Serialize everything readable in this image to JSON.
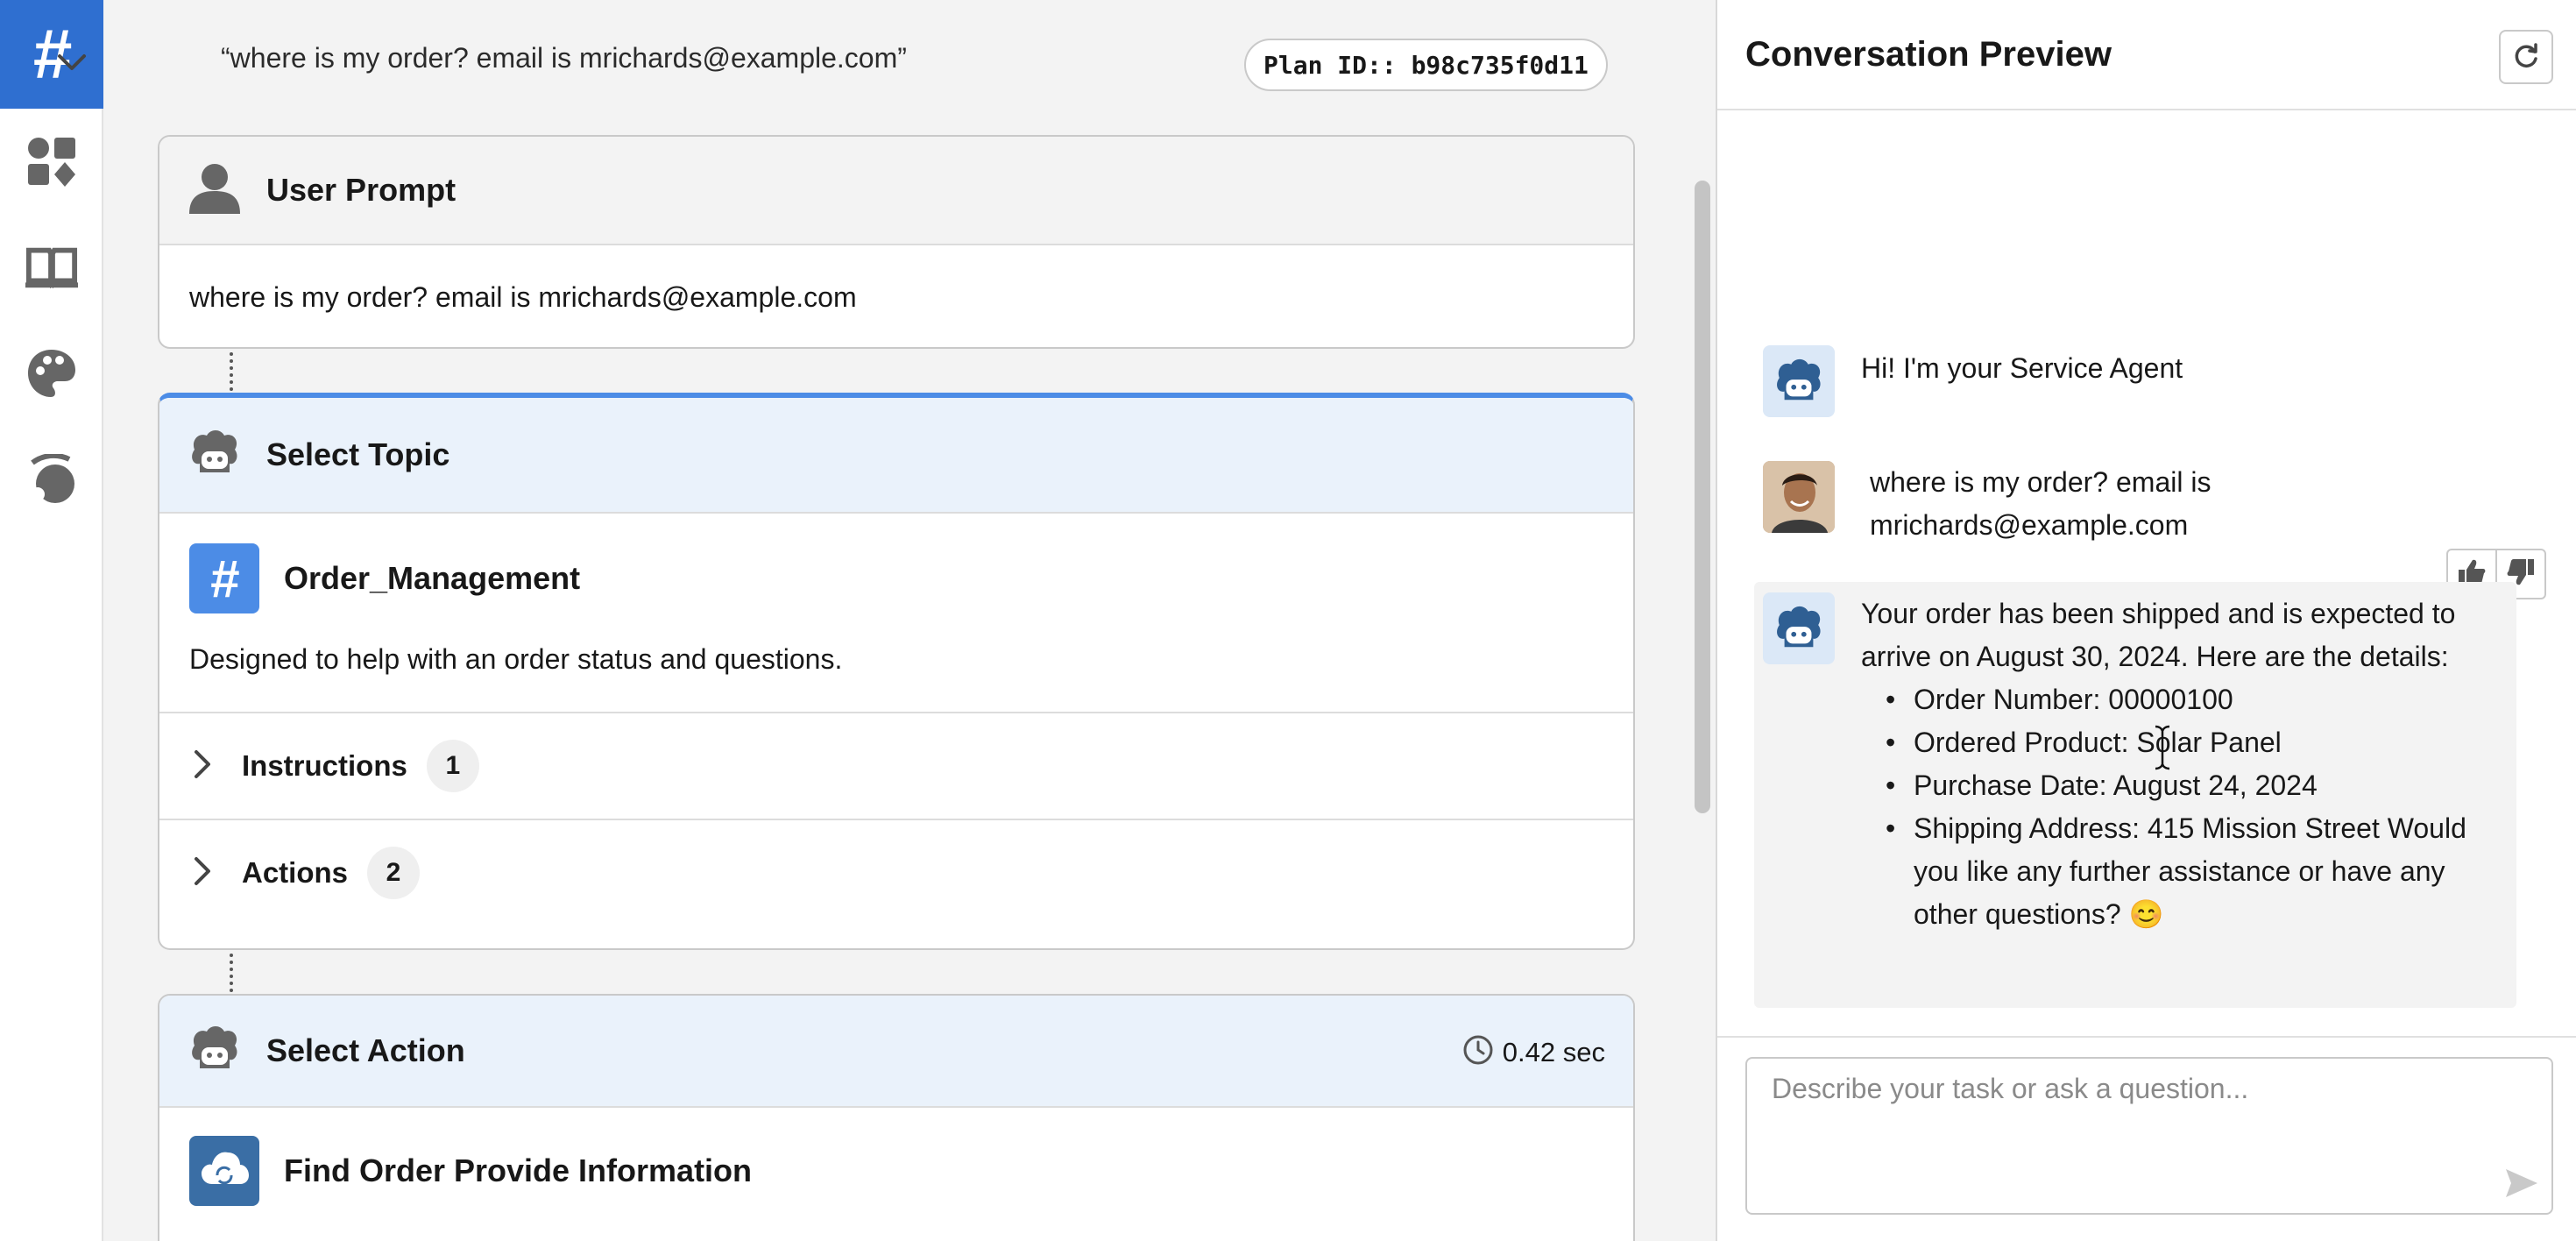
{
  "rail": {
    "top_icon": "hash-icon",
    "items": [
      {
        "icon": "components-icon"
      },
      {
        "icon": "book-icon"
      },
      {
        "icon": "palette-icon"
      },
      {
        "icon": "signal-icon"
      }
    ]
  },
  "plan": {
    "query": "“where is my order? email is mrichards@example.com”",
    "plan_id": "Plan ID:: b98c735f0d11"
  },
  "user_prompt": {
    "title": "User Prompt",
    "text": "where is my order? email is mrichards@example.com"
  },
  "select_topic": {
    "title": "Select Topic",
    "topic_name": "Order_Management",
    "description": "Designed to help with an order status and questions.",
    "instructions_label": "Instructions",
    "instructions_count": "1",
    "actions_label": "Actions",
    "actions_count": "2"
  },
  "select_action": {
    "title": "Select Action",
    "duration": "0.42 sec",
    "action_name": "Find Order Provide Information"
  },
  "preview": {
    "title": "Conversation Preview",
    "greeting": "Hi! I'm your Service Agent",
    "user_message": "where is my order? email is mrichards@example.com",
    "bot_intro": "Your order has been shipped and is expected to arrive on August 30, 2024. Here are the details:",
    "details": [
      "Order Number: 00000100",
      "Ordered Product: Solar Panel",
      "Purchase Date: August 24, 2024",
      "Shipping Address: 415 Mission Street Would you like any further assistance or have any other questions? 😊"
    ],
    "input_placeholder": "Describe your task or ask a question..."
  },
  "colors": {
    "brand_blue": "#2f6fd0",
    "topic_tile": "#4c8ce6",
    "header_blue": "#eaf2fb"
  }
}
